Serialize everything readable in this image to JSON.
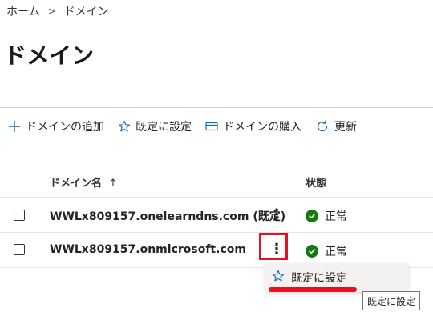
{
  "breadcrumb": {
    "home": "ホーム",
    "separator": ">",
    "current": "ドメイン"
  },
  "page": {
    "title": "ドメイン"
  },
  "toolbar": {
    "add_domain": {
      "label": "ドメインの追加",
      "icon": "plus-icon"
    },
    "set_default": {
      "label": "既定に設定",
      "icon": "star-icon"
    },
    "buy_domain": {
      "label": "ドメインの購入",
      "icon": "card-icon"
    },
    "refresh": {
      "label": "更新",
      "icon": "refresh-icon"
    }
  },
  "table": {
    "columns": {
      "domain_name": "ドメイン名",
      "sort_indicator": "↑",
      "status": "状態"
    },
    "rows": [
      {
        "domain": "WWLx809157.onelearndns.com (既定)",
        "status": "正常"
      },
      {
        "domain": "WWLx809157.onmicrosoft.com",
        "status": "正常"
      }
    ]
  },
  "context_menu": {
    "set_default_label": "既定に設定"
  },
  "tooltip": {
    "text": "既定に設定"
  },
  "colors": {
    "accent": "#0f6cbd",
    "status_ok": "#107c10",
    "highlight": "#e81123"
  }
}
